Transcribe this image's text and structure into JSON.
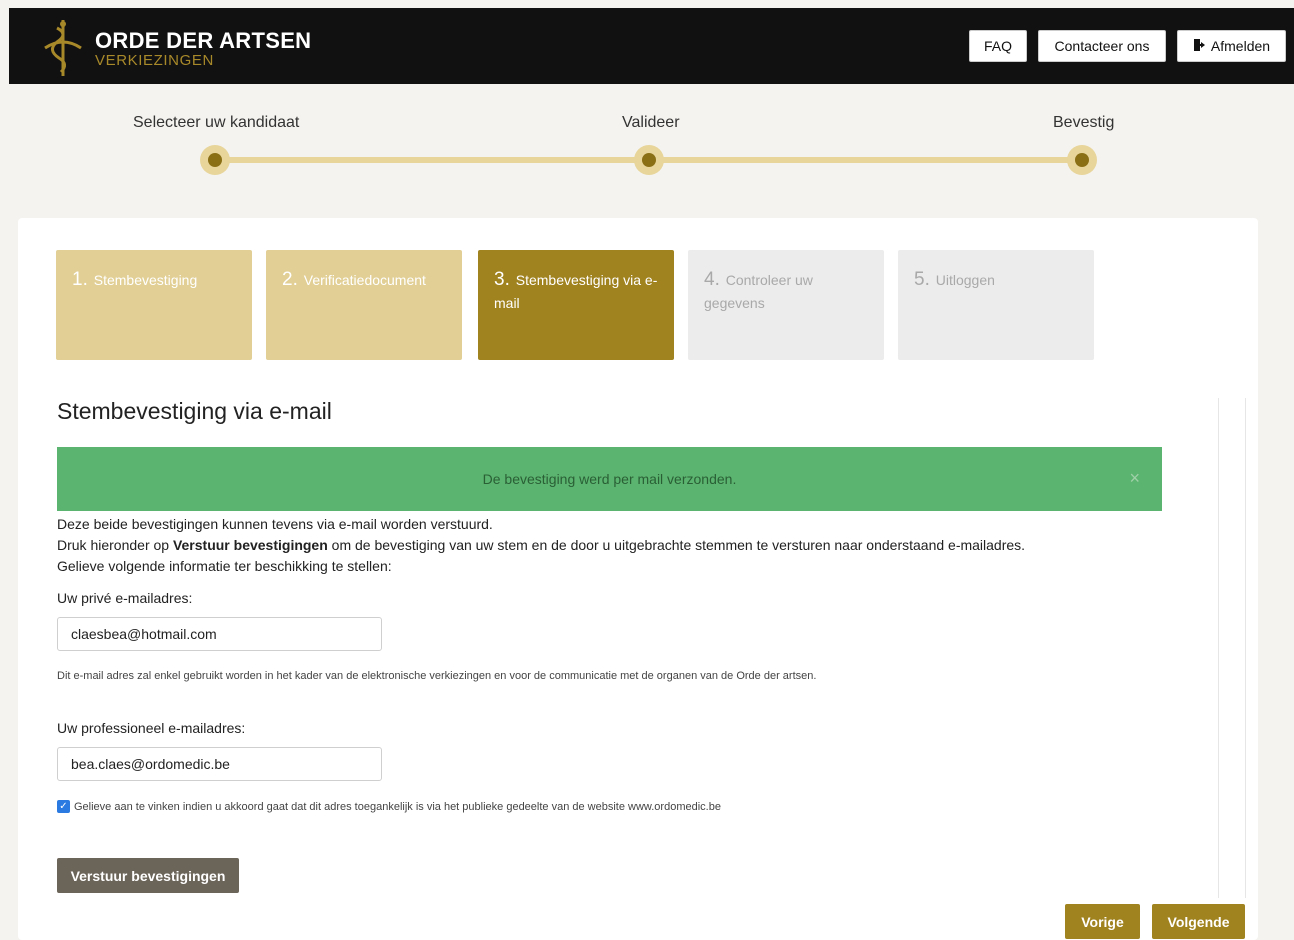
{
  "header": {
    "logo_title": "ORDE DER ARTSEN",
    "logo_subtitle": "VERKIEZINGEN",
    "faq_label": "FAQ",
    "contact_label": "Contacteer ons",
    "logout_label": "Afmelden"
  },
  "progress": {
    "steps": [
      {
        "label": "Selecteer uw kandidaat"
      },
      {
        "label": "Valideer"
      },
      {
        "label": "Bevestig"
      }
    ]
  },
  "wizard": {
    "steps": [
      {
        "num": "1.",
        "label": "Stembevestiging",
        "state": "done"
      },
      {
        "num": "2.",
        "label": "Verificatiedocument",
        "state": "done"
      },
      {
        "num": "3.",
        "label": "Stembevestiging via e-mail",
        "state": "active"
      },
      {
        "num": "4.",
        "label": "Controleer uw gegevens",
        "state": "todo"
      },
      {
        "num": "5.",
        "label": "Uitloggen",
        "state": "todo"
      }
    ]
  },
  "main": {
    "title": "Stembevestiging via e-mail",
    "alert_text": "De bevestiging werd per mail verzonden.",
    "alert_close": "×",
    "line1": "Deze beide bevestigingen kunnen tevens via e-mail worden verstuurd.",
    "line2_pre": "Druk hieronder op ",
    "line2_bold": "Verstuur bevestigingen",
    "line2_post": " om de bevestiging van uw stem en de door u uitgebrachte stemmen te versturen naar onderstaand e-mailadres.",
    "line3": "Gelieve volgende informatie ter beschikking te stellen:",
    "private_label": "Uw privé e-mailadres:",
    "private_value": "claesbea@hotmail.com",
    "private_help": "Dit e-mail adres zal enkel gebruikt worden in het kader van de elektronische verkiezingen en voor de communicatie met de organen van de Orde der artsen.",
    "prof_label": "Uw professioneel e-mailadres:",
    "prof_value": "bea.claes@ordomedic.be",
    "consent_checked": true,
    "consent_text": "Gelieve aan te vinken indien u akkoord gaat dat dit adres toegankelijk is via het publieke gedeelte van de website www.ordomedic.be",
    "send_label": "Verstuur bevestigingen",
    "prev_label": "Vorige",
    "next_label": "Volgende"
  },
  "colors": {
    "gold": "#a0821f",
    "gold_light": "#e1cf95",
    "success": "#5bb46f",
    "header_bg": "#111111"
  }
}
